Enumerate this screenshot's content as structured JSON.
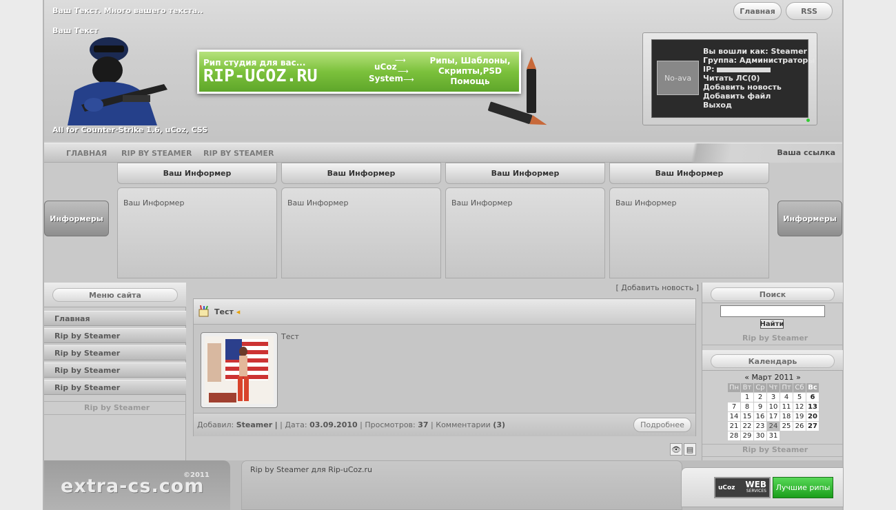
{
  "header": {
    "text1": "Ваш Текст. Много вашего текста..",
    "text2": "Ваш Текст",
    "text3": "All for Counter-Strike 1.6, uCoz, CSS",
    "btn_home": "Главная",
    "btn_rss": "RSS"
  },
  "banner": {
    "sub": "Рип студия для вас...",
    "main": "RIP-UCOZ.RU",
    "ucoz": "uCoz",
    "system": "System",
    "right_line1": "Рипы, Шаблоны,",
    "right_line2": "Скрипты,PSD",
    "right_line3": "Помощь"
  },
  "user": {
    "avatar": "No-ava",
    "logged_as": "Вы вошли как: Steamer",
    "group": "Группа: Администраторы",
    "ip_label": "IP:",
    "read_pm": "Читать ЛС(0)",
    "add_news": "Добавить новость",
    "add_file": "Добавить файл",
    "logout": "Выход"
  },
  "nav": {
    "items": [
      "ГЛАВНАЯ",
      "RIP BY STEAMER",
      "RIP BY STEAMER"
    ],
    "right": "Ваша ссылка"
  },
  "informers": {
    "side_left": "Информеры",
    "side_right": "Информеры",
    "titles": [
      "Ваш Информер",
      "Ваш Информер",
      "Ваш Информер",
      "Ваш Информер"
    ],
    "contents": [
      "Ваш Информер",
      "Ваш Информер",
      "Ваш Информер",
      "Ваш Информер"
    ]
  },
  "left_menu": {
    "title": "Меню сайта",
    "items": [
      "Главная",
      "Rip by Steamer",
      "Rip by Steamer",
      "Rip by Steamer",
      "Rip by Steamer"
    ],
    "footer_tag": "Rip by Steamer"
  },
  "center": {
    "add_news": "[ Добавить новость ]",
    "post": {
      "title": "Тест",
      "text": "Тест",
      "added_label": "Добавил:",
      "author": "Steamer",
      "date_label": "Дата:",
      "date": "03.09.2010",
      "views_label": "Просмотров:",
      "views": "37",
      "comments_label": "Комментарии",
      "comments": "(3)",
      "more": "Подробнее"
    }
  },
  "right_col": {
    "search_title": "Поиск",
    "search_btn": "Найти",
    "tag1": "Rip by Steamer",
    "calendar_title": "Календарь",
    "month": "Март 2011",
    "prev": "«",
    "next": "»",
    "weekdays": [
      "Пн",
      "Вт",
      "Ср",
      "Чт",
      "Пт",
      "Сб",
      "Вс"
    ],
    "tag2": "Rip by Steamer"
  },
  "footer": {
    "logo": "extra-cs.com",
    "year": "©2011",
    "credit": "Rip by Steamer для Rip-uCoz.ru",
    "ucoz_label": "uCoz",
    "web_label": "WEB",
    "services_label": "SERVICES",
    "best": "Лучшие рипы"
  },
  "colors": {
    "banner_green": "#7cc13c",
    "best_green": "#1b9e1b"
  }
}
